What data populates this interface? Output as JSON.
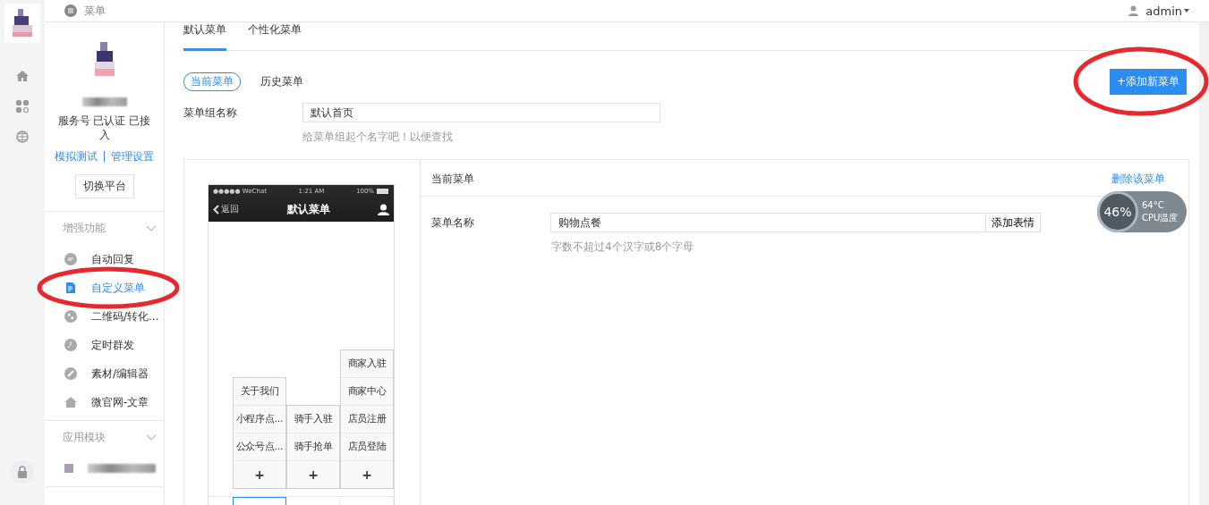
{
  "topbar": {
    "title": "菜单",
    "user": "admin"
  },
  "account": {
    "type": "服务号 已认证 已接入",
    "links": [
      "模拟测试",
      "管理设置"
    ],
    "separator": "|",
    "switch_button": "切换平台"
  },
  "sidebar_sections": [
    {
      "title": "增强功能",
      "items": [
        {
          "label": "自动回复",
          "selected": false
        },
        {
          "label": "自定义菜单",
          "selected": true
        },
        {
          "label": "二维码/转化...",
          "selected": false
        },
        {
          "label": "定时群发",
          "selected": false
        },
        {
          "label": "素材/编辑器",
          "selected": false
        },
        {
          "label": "微官网-文章",
          "selected": false
        }
      ]
    },
    {
      "title": "应用模块",
      "items": [
        {
          "kind": "redacted"
        }
      ]
    }
  ],
  "tabs": [
    {
      "label": "默认菜单",
      "selected": true
    },
    {
      "label": "个性化菜单",
      "selected": false
    }
  ],
  "subtabs": [
    {
      "label": "当前菜单",
      "selected": true
    },
    {
      "label": "历史菜单",
      "selected": false
    }
  ],
  "add_button": "+添加新菜单",
  "group_name": {
    "label": "菜单组名称",
    "value": "默认首页",
    "hint": "给菜单组起个名字吧！以便查找"
  },
  "phone": {
    "carrier": "●●●●● WeChat",
    "time": "1:21 AM",
    "battery": "100%",
    "back": "返回",
    "title": "默认菜单",
    "columns": [
      {
        "items": [
          "关于我们",
          "小程序点...",
          "公众号点..."
        ],
        "add": "+",
        "selected": true
      },
      {
        "items": [
          "骑手入驻",
          "骑手抢单"
        ],
        "add": "+",
        "selected": false
      },
      {
        "items": [
          "商家入驻",
          "商家中心",
          "店员注册",
          "店员登陆"
        ],
        "add": "+",
        "selected": false
      }
    ]
  },
  "editor": {
    "title": "当前菜单",
    "delete_link": "删除该菜单",
    "name_label": "菜单名称",
    "name_value": "购物点餐",
    "emoji_button": "添加表情",
    "hint": "字数不超过4个汉字或8个字母"
  },
  "cpu_widget": {
    "percent": "46%",
    "temp": "64°C",
    "label": "CPU温度"
  }
}
